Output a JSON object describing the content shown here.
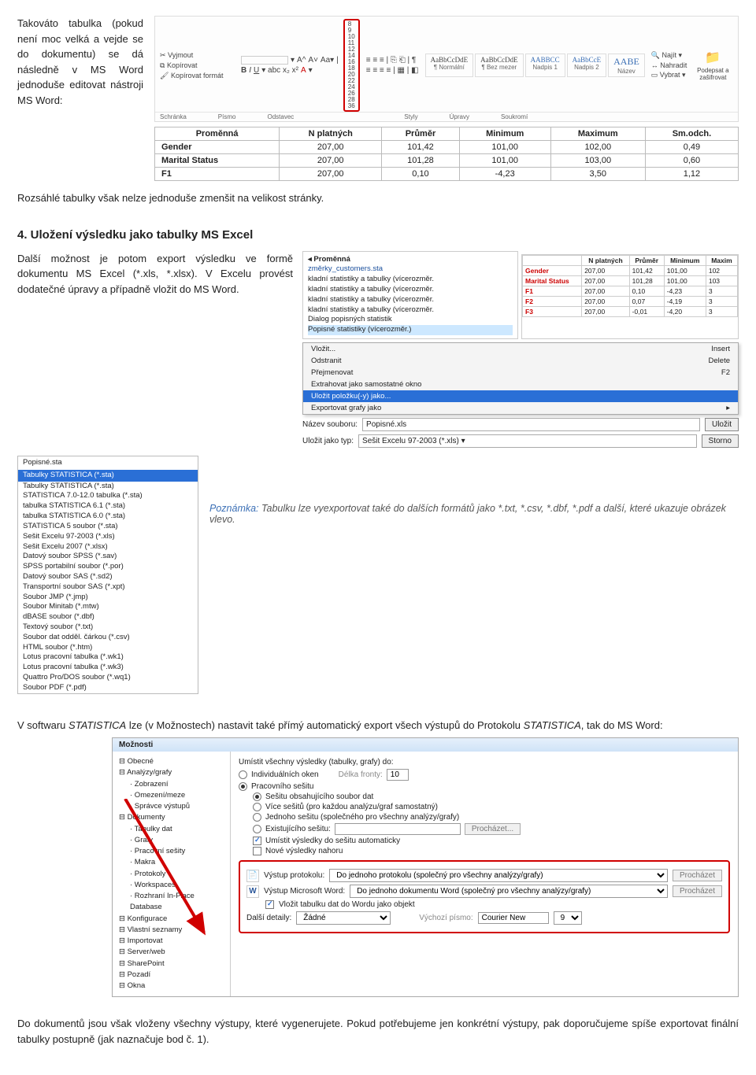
{
  "intro": {
    "p1": "Takováto tabulka (pokud není moc velká a vejde se do dokumentu) se dá následně v MS Word jednoduše editovat nástroji MS Word:",
    "p2": "Rozsáhlé tabulky však nelze jednoduše zmenšit na velikost stránky."
  },
  "ribbon": {
    "cut": "Vyjmout",
    "copy": "Kopírovat",
    "fmt": "Kopírovat formát",
    "clipboard": "Schránka",
    "font_label": "Písmo",
    "para_label": "Odstavec",
    "styles_label": "Styly",
    "edit_label": "Úpravy",
    "priv_label": "Soukromí",
    "fontsizes": [
      "8",
      "9",
      "10",
      "11",
      "12",
      "14",
      "16",
      "18",
      "20",
      "22",
      "24",
      "26",
      "28",
      "36"
    ],
    "s1": "AaBbCcDdE",
    "s1b": "¶ Normální",
    "s2": "AaBbCcDdE",
    "s2b": "¶ Bez mezer",
    "s3": "AABBCC",
    "s3b": "Nadpis 1",
    "s4": "AaBbCcE",
    "s4b": "Nadpis 2",
    "s5": "AABE",
    "s5b": "Název",
    "find": "Najít",
    "replace": "Nahradit",
    "select": "Vybrat",
    "sign": "Podepsat a zašifrovat"
  },
  "table": {
    "h": [
      "Proměnná",
      "N platných",
      "Průměr",
      "Minimum",
      "Maximum",
      "Sm.odch."
    ],
    "rows": [
      [
        "Gender",
        "207,00",
        "101,42",
        "101,00",
        "102,00",
        "0,49"
      ],
      [
        "Marital Status",
        "207,00",
        "101,28",
        "101,00",
        "103,00",
        "0,60"
      ],
      [
        "F1",
        "207,00",
        "0,10",
        "-4,23",
        "3,50",
        "1,12"
      ]
    ]
  },
  "h4": "4. Uložení výsledku jako tabulky MS Excel",
  "s4text": "Další možnost je potom export výsledku ve formě dokumentu MS Excel (*.xls, *.xlsx). V Excelu provést dodatečné úpravy a případně vložit do MS Word.",
  "sec4": {
    "tree_title": "Proměnná",
    "tree_items": [
      "změrky_customers.sta",
      "kladní statistiky a tabulky (vícerozměr.",
      "kladní statistiky a tabulky (vícerozměr.",
      "kladní statistiky a tabulky (vícerozměr.",
      "kladní statistiky a tabulky (vícerozměr.",
      "Dialog popisných statistik",
      "Popisné statistiky (vícerozměr.)"
    ],
    "mini_h": [
      "",
      "N platných",
      "Průměr",
      "Minimum",
      "Maxim"
    ],
    "mini_rows": [
      [
        "Gender",
        "207,00",
        "101,42",
        "101,00",
        "102"
      ],
      [
        "Marital Status",
        "207,00",
        "101,28",
        "101,00",
        "103"
      ],
      [
        "F1",
        "207,00",
        "0,10",
        "-4,23",
        "3"
      ],
      [
        "F2",
        "207,00",
        "0,07",
        "-4,19",
        "3"
      ],
      [
        "F3",
        "207,00",
        "-0,01",
        "-4,20",
        "3"
      ]
    ],
    "ctx": {
      "i1": "Vložit...",
      "i1k": "Insert",
      "i2": "Odstranit",
      "i2k": "Delete",
      "i3": "Přejmenovat",
      "i3k": "F2",
      "i4": "Extrahovat jako samostatné okno",
      "i5": "Uložit položku(-y) jako...",
      "i6": "Exportovat grafy jako"
    },
    "save_name_lbl": "Název souboru:",
    "save_name_val": "Popisné.xls",
    "save_type_lbl": "Uložit jako typ:",
    "save_type_val": "Sešit Excelu 97-2003 (*.xls)",
    "btn_save": "Uložit",
    "btn_cancel": "Storno"
  },
  "filetypes": {
    "header": "Popisné.sta",
    "sel": "Tabulky STATISTICA (*.sta)",
    "items": [
      "Tabulky STATISTICA (*.sta)",
      "STATISTICA 7.0-12.0 tabulka (*.sta)",
      "tabulka STATISTICA 6.1 (*.sta)",
      "tabulka STATISTICA 6.0 (*.sta)",
      "STATISTICA 5 soubor (*.sta)",
      "Sešit Excelu 97-2003 (*.xls)",
      "Sešit Excelu 2007 (*.xlsx)",
      "Datový soubor SPSS (*.sav)",
      "SPSS portabilní soubor (*.por)",
      "Datový soubor SAS (*.sd2)",
      "Transportní soubor SAS (*.xpt)",
      "Soubor JMP (*.jmp)",
      "Soubor Minitab (*.mtw)",
      "dBASE soubor (*.dbf)",
      "Textový soubor (*.txt)",
      "Soubor dat odděl. čárkou (*.csv)",
      "HTML soubor (*.htm)",
      "Lotus pracovní tabulka (*.wk1)",
      "Lotus pracovní tabulka (*.wk3)",
      "Quattro Pro/DOS soubor (*.wq1)",
      "Soubor PDF (*.pdf)"
    ]
  },
  "note": {
    "label": "Poznámka:",
    "text": " Tabulku lze vyexportovat také do dalších formátů jako *.txt, *.csv, *.dbf, *.pdf a další, které ukazuje obrázek vlevo."
  },
  "p5": "V softwaru STATISTICA lze (v Možnostech) nastavit také přímý automatický export všech výstupů do Protokolu STATISTICA, tak do MS Word:",
  "options": {
    "title": "Možnosti",
    "tree": [
      {
        "t": "Obecné",
        "lv": 1
      },
      {
        "t": "Analýzy/grafy",
        "lv": 1
      },
      {
        "t": "Zobrazení",
        "lv": 2
      },
      {
        "t": "Omezení/meze",
        "lv": 2
      },
      {
        "t": "Správce výstupů",
        "lv": 2
      },
      {
        "t": "Dokumenty",
        "lv": 1
      },
      {
        "t": "Tabulky dat",
        "lv": 2
      },
      {
        "t": "Grafy",
        "lv": 2
      },
      {
        "t": "Pracovní sešity",
        "lv": 2
      },
      {
        "t": "Makra",
        "lv": 2
      },
      {
        "t": "Protokoly",
        "lv": 2
      },
      {
        "t": "Workspaces",
        "lv": 2
      },
      {
        "t": "Rozhraní In-Place Database",
        "lv": 2
      },
      {
        "t": "Konfigurace",
        "lv": 1
      },
      {
        "t": "Vlastní seznamy",
        "lv": 1
      },
      {
        "t": "Importovat",
        "lv": 1
      },
      {
        "t": "Server/web",
        "lv": 1
      },
      {
        "t": "SharePoint",
        "lv": 1
      },
      {
        "t": "Pozadí",
        "lv": 1
      },
      {
        "t": "Okna",
        "lv": 1
      }
    ],
    "hdr": "Umístit všechny výsledky (tabulky, grafy) do:",
    "r1": "Individuálních oken",
    "qlen": "Délka fronty:",
    "qval": "10",
    "r2": "Pracovního sešitu",
    "rb1": "Sešitu obsahujícího soubor dat",
    "rb2": "Více sešitů (pro každou analýzu/graf samostatný)",
    "rb3": "Jednoho sešitu (společného pro všechny analýzy/grafy)",
    "rb4": "Existujícího sešitu:",
    "browse": "Procházet...",
    "ck1": "Umístit výsledky do sešitu automaticky",
    "ck2": "Nové výsledky nahoru",
    "vp_lbl": "Výstup protokolu:",
    "vp_val": "Do jednoho protokolu (společný pro všechny analýzy/grafy)",
    "vw_lbl": "Výstup Microsoft Word:",
    "vw_val": "Do jednoho dokumentu Word (společný pro všechny analýzy/grafy)",
    "ck3": "Vložit tabulku dat do Wordu jako objekt",
    "dd_lbl": "Další detaily:",
    "dd_val": "Žádné",
    "font_lbl": "Výchozí písmo:",
    "font_val": "Courier New",
    "size_val": "9",
    "browse2": "Procházet"
  },
  "p6": "Do dokumentů jsou však vloženy všechny výstupy, které vygenerujete. Pokud potřebujeme jen konkrétní výstupy, pak doporučujeme spíše exportovat finální tabulky postupně (jak naznačuje bod č. 1)."
}
